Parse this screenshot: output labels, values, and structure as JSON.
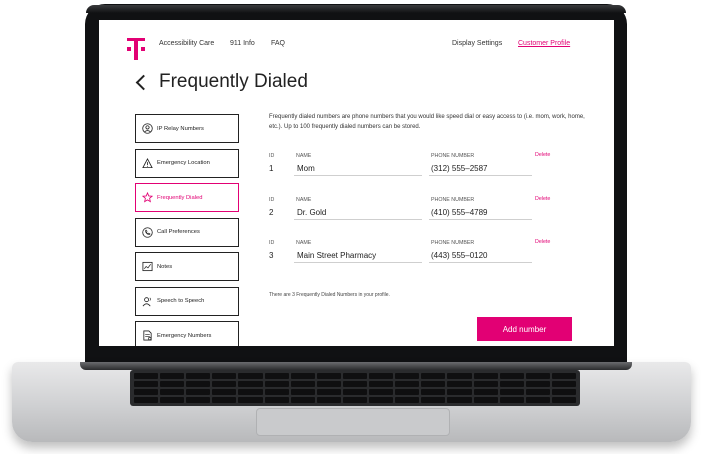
{
  "nav": {
    "links": [
      "Accessibility Care",
      "911 Info",
      "FAQ"
    ],
    "right_links": [
      "Display Settings",
      "Customer Profile"
    ]
  },
  "page": {
    "title": "Frequently Dialed"
  },
  "sidebar": {
    "items": [
      {
        "label": "IP Relay Numbers",
        "icon": "person-circle-icon"
      },
      {
        "label": "Emergency Location",
        "icon": "warning-triangle-icon"
      },
      {
        "label": "Frequently Dialed",
        "icon": "star-icon",
        "active": true
      },
      {
        "label": "Call Preferences",
        "icon": "phone-icon"
      },
      {
        "label": "Notes",
        "icon": "chart-icon"
      },
      {
        "label": "Speech to Speech",
        "icon": "speech-person-icon"
      },
      {
        "label": "Emergency Numbers",
        "icon": "document-icon"
      }
    ]
  },
  "main": {
    "intro": "Frequently dialed numbers are phone numbers that you would like speed dial or easy access to (i.e. mom, work, home, etc.). Up to 100 frequently dialed numbers can be stored.",
    "headers": {
      "id": "ID",
      "name": "NAME",
      "phone": "PHONE NUMBER"
    },
    "delete_label": "Delete",
    "rows": [
      {
        "id": "1",
        "name": "Mom",
        "phone": "(312) 555–2587"
      },
      {
        "id": "2",
        "name": "Dr. Gold",
        "phone": "(410) 555–4789"
      },
      {
        "id": "3",
        "name": "Main Street Pharmacy",
        "phone": "(443) 555–0120"
      }
    ],
    "count_text": "There are 3 Frequently Dialed Numbers in your profile.",
    "add_button": "Add number"
  },
  "colors": {
    "accent": "#e20074"
  }
}
